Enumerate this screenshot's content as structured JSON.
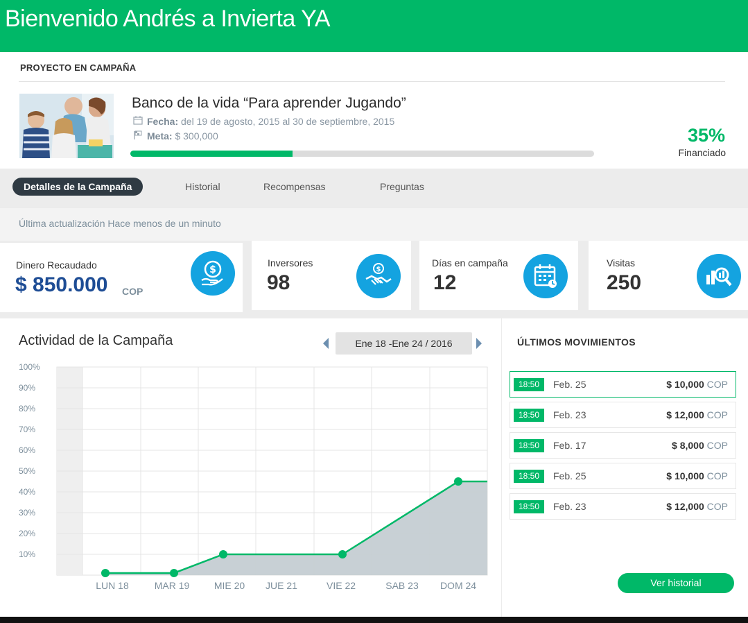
{
  "header": {
    "title": "Bienvenido Andrés a Invierta YA"
  },
  "project": {
    "section_title": "PROYECTO EN CAMPAÑA",
    "name": "Banco de la vida “Para aprender Jugando”",
    "date_label": "Fecha:",
    "date_value": "del 19 de agosto, 2015 al 30 de septiembre, 2015",
    "goal_label": "Meta:",
    "goal_value": "$ 300,000",
    "progress_percent": 35,
    "funded_pct": "35%",
    "funded_label": "Financiado"
  },
  "tabs": [
    {
      "label": "Detalles de la Campaña",
      "active": true
    },
    {
      "label": "Historial",
      "active": false
    },
    {
      "label": "Recompensas",
      "active": false
    },
    {
      "label": "Preguntas",
      "active": false
    }
  ],
  "last_update": "Última actualización Hace menos de un minuto",
  "stats": [
    {
      "label": "Dinero Recaudado",
      "value": "$ 850.000",
      "unit": "COP",
      "icon": "money-hand-icon"
    },
    {
      "label": "Inversores",
      "value": "98",
      "icon": "handshake-icon"
    },
    {
      "label": "Días en campaña",
      "value": "12",
      "icon": "calendar-icon"
    },
    {
      "label": "Visitas",
      "value": "250",
      "icon": "analytics-search-icon"
    }
  ],
  "activity": {
    "title": "Actividad de la Campaña",
    "week": "Ene 18 -Ene 24 / 2016"
  },
  "chart_data": {
    "type": "area",
    "categories": [
      "LUN 18",
      "MAR 19",
      "MIE 20",
      "JUE 21",
      "VIE 22",
      "SAB 23",
      "DOM 24"
    ],
    "y_tick_labels": [
      "100%",
      "90%",
      "80%",
      "70%",
      "60%",
      "50%",
      "40%",
      "30%",
      "20%",
      "10%"
    ],
    "ylim": [
      0,
      100
    ],
    "grid": true,
    "points": [
      {
        "x": "LUN 18",
        "y": 1
      },
      {
        "x": "MAR 19",
        "y": 1
      },
      {
        "x": "MIE 20",
        "y": 10
      },
      {
        "x": "VIE 22",
        "y": 10
      },
      {
        "x": "DOM 24",
        "y": 45
      }
    ],
    "line_color": "#00b868",
    "fill_color": "#c5cdd3"
  },
  "movements": {
    "title": "ÚLTIMOS MOVIMIENTOS",
    "items": [
      {
        "time": "18:50",
        "date": "Feb. 25",
        "amount": "$ 10,000",
        "currency": "COP",
        "selected": true
      },
      {
        "time": "18:50",
        "date": "Feb. 23",
        "amount": "$ 12,000",
        "currency": "COP",
        "selected": false
      },
      {
        "time": "18:50",
        "date": "Feb. 17",
        "amount": "$ 8,000",
        "currency": "COP",
        "selected": false
      },
      {
        "time": "18:50",
        "date": "Feb. 25",
        "amount": "$ 10,000",
        "currency": "COP",
        "selected": false
      },
      {
        "time": "18:50",
        "date": "Feb. 23",
        "amount": "$ 12,000",
        "currency": "COP",
        "selected": false
      }
    ],
    "history_button": "Ver historial"
  },
  "colors": {
    "brand": "#00b868",
    "icon_bg": "#14a3e0",
    "tab_active": "#2f3a43",
    "money": "#1e4d95"
  }
}
